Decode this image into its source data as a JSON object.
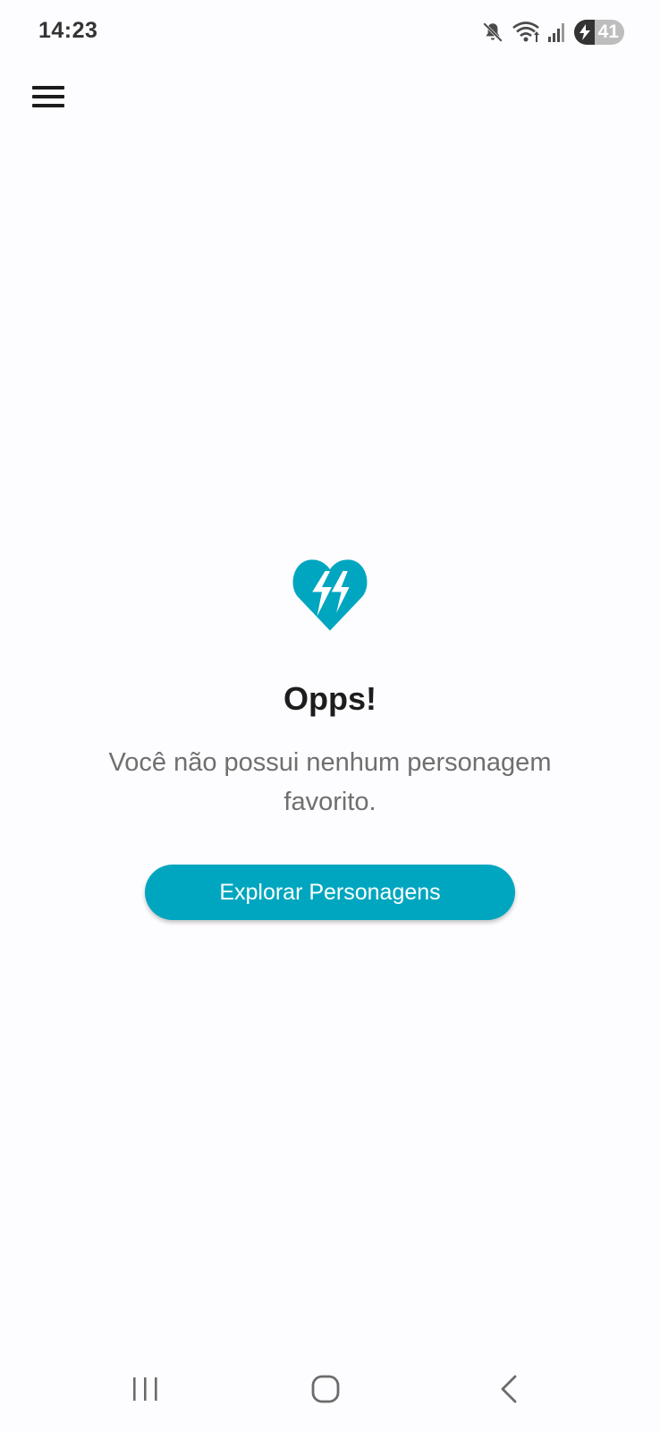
{
  "status_bar": {
    "time": "14:23",
    "battery_level": "41",
    "icons": [
      "mute-icon",
      "wifi-icon",
      "signal-icon",
      "battery-icon"
    ]
  },
  "app_bar": {
    "menu_icon": "menu-icon"
  },
  "empty_state": {
    "icon": "broken-heart-icon",
    "title": "Opps!",
    "message": "Você não possui nenhum personagem favorito.",
    "button_label": "Explorar Personagens"
  },
  "nav_bar": {
    "icons": [
      "recent-apps-icon",
      "home-icon",
      "back-icon"
    ]
  },
  "colors": {
    "accent": "#00a6bf",
    "background": "#fdfcfe",
    "title": "#1d1d1d",
    "message": "#6f6f6f"
  }
}
